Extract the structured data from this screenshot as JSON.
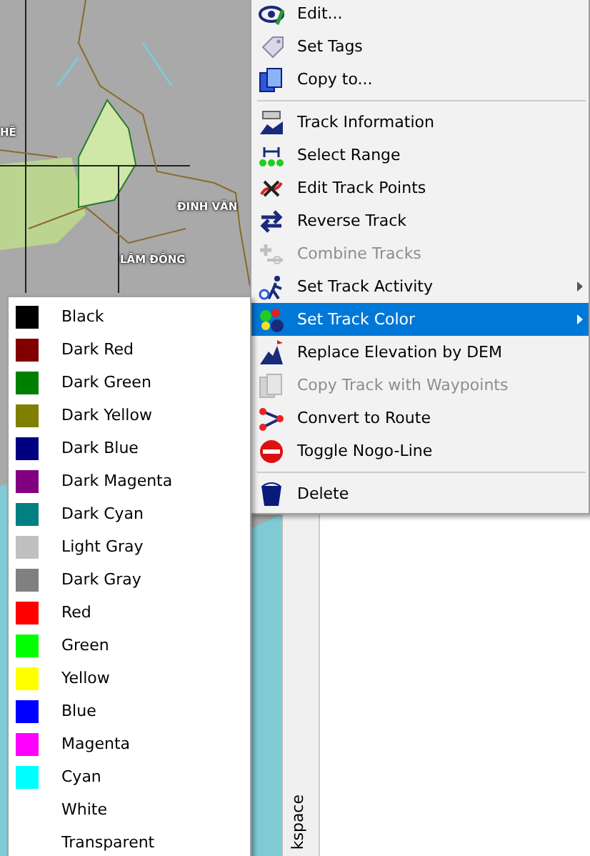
{
  "map": {
    "labels": [
      {
        "text": "HÊ"
      },
      {
        "text": "ĐINH VĂN"
      },
      {
        "text": "LÂM ĐỒNG"
      }
    ]
  },
  "side_panel": {
    "label": "kspace"
  },
  "context_menu": {
    "items": [
      {
        "kind": "item",
        "label": "Edit...",
        "disabled": false,
        "selected": false,
        "submenu": false
      },
      {
        "kind": "item",
        "label": "Set Tags",
        "disabled": false,
        "selected": false,
        "submenu": false
      },
      {
        "kind": "item",
        "label": "Copy to...",
        "disabled": false,
        "selected": false,
        "submenu": false
      },
      {
        "kind": "separator"
      },
      {
        "kind": "item",
        "label": "Track Information",
        "disabled": false,
        "selected": false,
        "submenu": false
      },
      {
        "kind": "item",
        "label": "Select Range",
        "disabled": false,
        "selected": false,
        "submenu": false
      },
      {
        "kind": "item",
        "label": "Edit Track Points",
        "disabled": false,
        "selected": false,
        "submenu": false
      },
      {
        "kind": "item",
        "label": "Reverse Track",
        "disabled": false,
        "selected": false,
        "submenu": false
      },
      {
        "kind": "item",
        "label": "Combine Tracks",
        "disabled": true,
        "selected": false,
        "submenu": false
      },
      {
        "kind": "item",
        "label": "Set Track Activity",
        "disabled": false,
        "selected": false,
        "submenu": true
      },
      {
        "kind": "item",
        "label": "Set Track Color",
        "disabled": false,
        "selected": true,
        "submenu": true
      },
      {
        "kind": "item",
        "label": "Replace Elevation by DEM",
        "disabled": false,
        "selected": false,
        "submenu": false
      },
      {
        "kind": "item",
        "label": "Copy Track with Waypoints",
        "disabled": true,
        "selected": false,
        "submenu": false
      },
      {
        "kind": "item",
        "label": "Convert to Route",
        "disabled": false,
        "selected": false,
        "submenu": false
      },
      {
        "kind": "item",
        "label": "Toggle Nogo-Line",
        "disabled": false,
        "selected": false,
        "submenu": false
      },
      {
        "kind": "separator"
      },
      {
        "kind": "item",
        "label": "Delete",
        "disabled": false,
        "selected": false,
        "submenu": false
      }
    ]
  },
  "color_submenu": {
    "items": [
      {
        "label": "Black",
        "color": "#000000"
      },
      {
        "label": "Dark Red",
        "color": "#800000"
      },
      {
        "label": "Dark Green",
        "color": "#008000"
      },
      {
        "label": "Dark Yellow",
        "color": "#808000"
      },
      {
        "label": "Dark Blue",
        "color": "#000080"
      },
      {
        "label": "Dark Magenta",
        "color": "#800080"
      },
      {
        "label": "Dark Cyan",
        "color": "#008080"
      },
      {
        "label": "Light Gray",
        "color": "#c0c0c0"
      },
      {
        "label": "Dark Gray",
        "color": "#808080"
      },
      {
        "label": "Red",
        "color": "#ff0000"
      },
      {
        "label": "Green",
        "color": "#00ff00"
      },
      {
        "label": "Yellow",
        "color": "#ffff00"
      },
      {
        "label": "Blue",
        "color": "#0000ff"
      },
      {
        "label": "Magenta",
        "color": "#ff00ff"
      },
      {
        "label": "Cyan",
        "color": "#00ffff"
      },
      {
        "label": "White"
      },
      {
        "label": "Transparent"
      }
    ]
  }
}
